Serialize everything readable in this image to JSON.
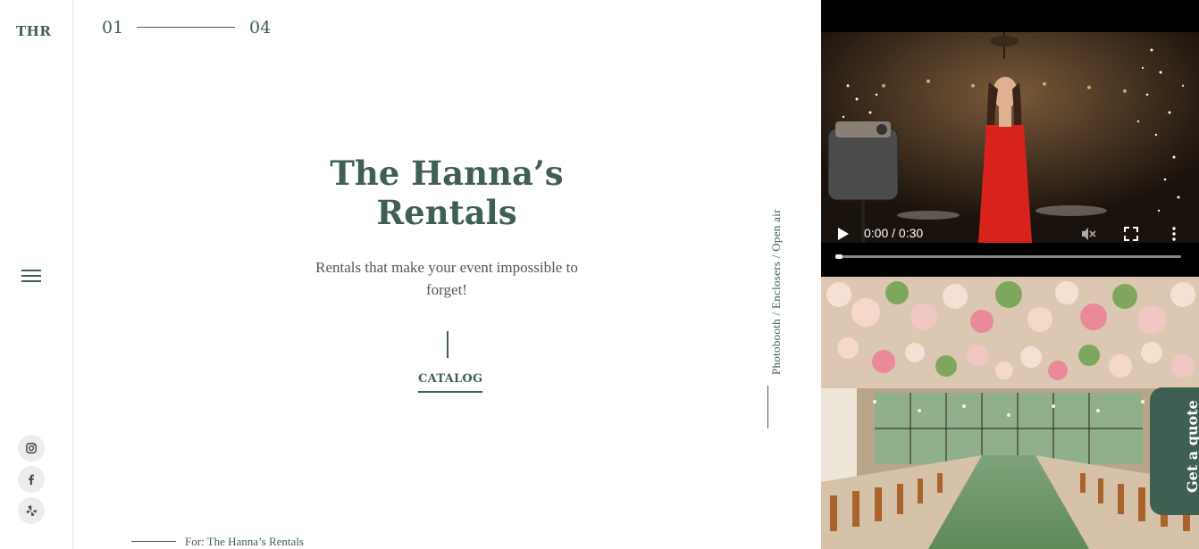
{
  "brand": {
    "logo_text": "THR"
  },
  "counter": {
    "current": "01",
    "total": "04"
  },
  "hero": {
    "title_line1": "The Hanna’s",
    "title_line2": "Rentals",
    "subtitle_line1": "Rentals that make your event impossible to",
    "subtitle_line2": "forget!",
    "cta_label": "CATALOG"
  },
  "categories_text": "Photobooth / Enclosers / Open air",
  "credit": {
    "text": "For: The Hanna’s Rentals"
  },
  "sidebar": {
    "menu_icon": "hamburger-menu-icon",
    "social": [
      {
        "name": "instagram-icon"
      },
      {
        "name": "facebook-icon"
      },
      {
        "name": "yelp-icon"
      }
    ]
  },
  "video": {
    "time": "0:00 / 0:30",
    "progress": 0.0,
    "muted": true
  },
  "quote_tab": {
    "label": "Get a quote"
  },
  "colors": {
    "brand_green": "#3e5f52",
    "sidebar_border": "#e4e4e4",
    "social_bg": "#ececec"
  }
}
